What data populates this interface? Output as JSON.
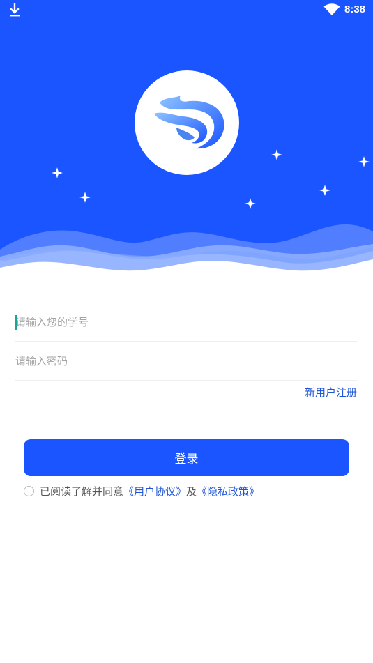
{
  "status_bar": {
    "time": "8:38",
    "icons": [
      "download-icon",
      "wifi-icon"
    ]
  },
  "brand": {
    "logo": "brand-logo",
    "hero_color": "#1a55ff",
    "wave_colors": [
      "#5b86ff",
      "#8caeff"
    ]
  },
  "login_form": {
    "student_id_placeholder": "请输入您的学号",
    "password_placeholder": "请输入密码",
    "register_link": "新用户注册",
    "login_button": "登录"
  },
  "agreement": {
    "prefix": "已阅读了解并同意",
    "user_agreement": "《用户协议》",
    "conjunction": "及",
    "privacy_policy": "《隐私政策》",
    "checked": false
  },
  "colors": {
    "primary": "#1a55ff",
    "link": "#1f55d6",
    "caret": "#1aa59a"
  }
}
